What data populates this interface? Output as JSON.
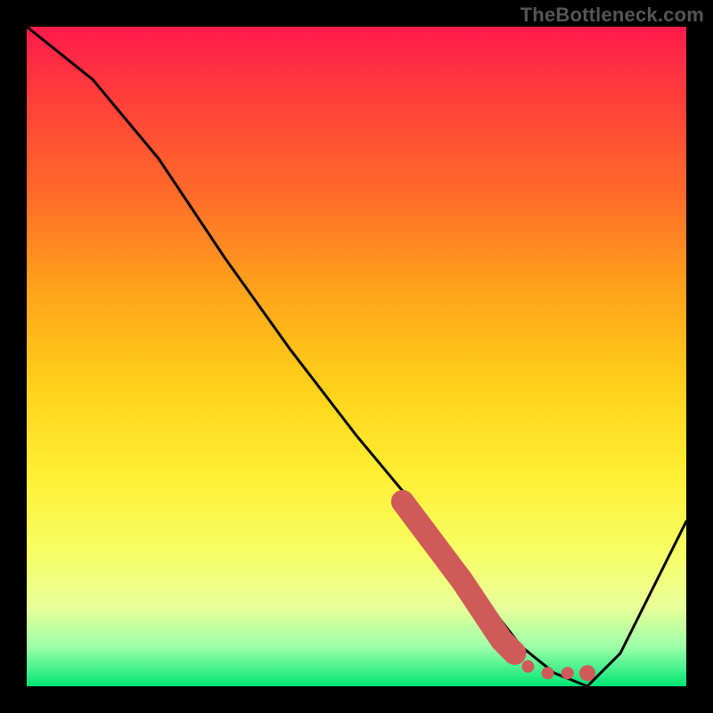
{
  "watermark": "TheBottleneck.com",
  "colors": {
    "frame_bg": "#000000",
    "gradient_top": "#ff1a4d",
    "gradient_bottom": "#00e676",
    "curve": "#000000",
    "marker": "#d05a5a"
  },
  "chart_data": {
    "type": "line",
    "title": "",
    "xlabel": "",
    "ylabel": "",
    "xlim": [
      0,
      100
    ],
    "ylim": [
      0,
      100
    ],
    "grid": false,
    "legend": false,
    "series": [
      {
        "name": "curve",
        "x": [
          0,
          10,
          20,
          30,
          40,
          50,
          60,
          68,
          75,
          80,
          85,
          90,
          95,
          100
        ],
        "values": [
          100,
          92,
          80,
          65,
          51,
          38,
          26,
          15,
          6,
          2,
          0,
          5,
          15,
          25
        ]
      }
    ],
    "annotations": [
      {
        "kind": "marker-strip",
        "color": "#d05a5a",
        "x": [
          57,
          60,
          63,
          66,
          68,
          70,
          72,
          74,
          76,
          79,
          82,
          85
        ],
        "values": [
          28,
          24,
          20,
          16,
          13,
          10,
          7,
          5,
          3,
          2,
          2,
          2
        ]
      }
    ]
  }
}
